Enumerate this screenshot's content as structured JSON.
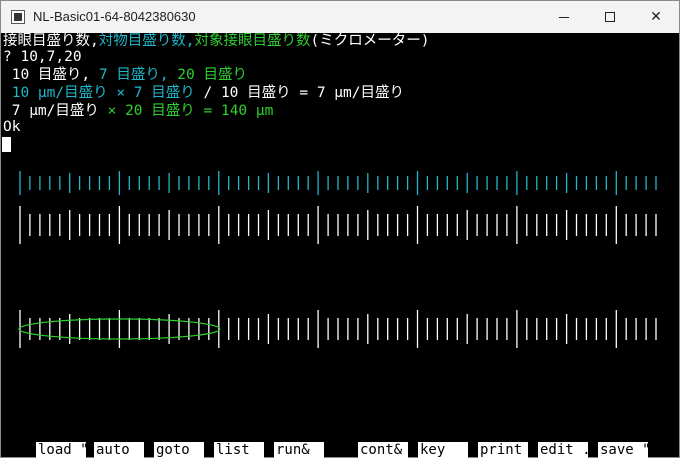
{
  "window": {
    "title": "NL-Basic01-64-8042380630",
    "minimize_glyph": "—",
    "maximize_glyph": "□",
    "close_glyph": "✕"
  },
  "console": {
    "line1": [
      {
        "text": "接眼目盛り数,",
        "color": "white"
      },
      {
        "text": "対物目盛り数,",
        "color": "cyan"
      },
      {
        "text": "対象接眼目盛り数",
        "color": "green"
      },
      {
        "text": "(ミクロメーター)",
        "color": "white"
      }
    ],
    "line2": "? 10,7,20",
    "line3": [
      {
        "text": " 10 目盛り,",
        "color": "white"
      },
      {
        "text": " 7 目盛り,",
        "color": "cyan"
      },
      {
        "text": " 20 目盛り",
        "color": "green"
      }
    ],
    "line4": [
      {
        "text": " 10 μm/目盛り",
        "color": "cyan"
      },
      {
        "text": " × 7 目盛り",
        "color": "cyan"
      },
      {
        "text": " / 10 目盛り = 7 μm/目盛り",
        "color": "white"
      }
    ],
    "line5": [
      {
        "text": " 7 μm/目盛り",
        "color": "white"
      },
      {
        "text": " × 20 目盛り = 140 μm",
        "color": "green"
      }
    ],
    "line6": "Ok"
  },
  "colors": {
    "cyan": "#1fb7c9",
    "green": "#2fcf2f",
    "white": "#ffffff",
    "background": "#000000"
  },
  "scales": {
    "objective_ticks": 65,
    "eyepiece_ticks": 65,
    "measured_ticks": 65,
    "highlight_span_ticks": 20
  },
  "function_keys": [
    "load \"",
    "auto",
    "goto",
    "list",
    "run&",
    "",
    "cont&",
    "key",
    "print",
    "edit .",
    "save \""
  ]
}
